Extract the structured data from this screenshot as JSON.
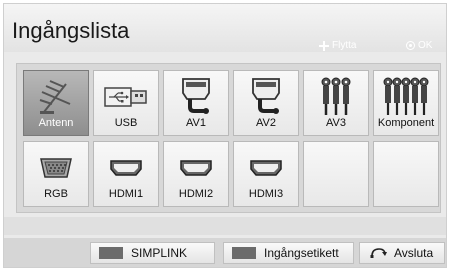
{
  "window": {
    "title": "Ingångslista",
    "hints": {
      "move": "Flytta",
      "ok": "OK"
    }
  },
  "inputs": [
    {
      "label": "Antenn",
      "icon": "antenna-icon",
      "selected": true
    },
    {
      "label": "USB",
      "icon": "usb-icon",
      "selected": false
    },
    {
      "label": "AV1",
      "icon": "scart-icon",
      "selected": false
    },
    {
      "label": "AV2",
      "icon": "scart-icon",
      "selected": false
    },
    {
      "label": "AV3",
      "icon": "rca-3-icon",
      "selected": false
    },
    {
      "label": "Komponent",
      "icon": "rca-5-icon",
      "selected": false
    },
    {
      "label": "RGB",
      "icon": "vga-icon",
      "selected": false
    },
    {
      "label": "HDMI1",
      "icon": "hdmi-icon",
      "selected": false
    },
    {
      "label": "HDMI2",
      "icon": "hdmi-icon",
      "selected": false
    },
    {
      "label": "HDMI3",
      "icon": "hdmi-icon",
      "selected": false
    },
    {
      "label": "",
      "icon": "",
      "selected": false
    },
    {
      "label": "",
      "icon": "",
      "selected": false
    }
  ],
  "footer": {
    "simplink": "SIMPLINK",
    "input_label": "Ingångsetikett",
    "exit": "Avsluta"
  },
  "colors": {
    "selected_tile": "#9a9a9a",
    "button_swatch": "#6b6b6b"
  }
}
